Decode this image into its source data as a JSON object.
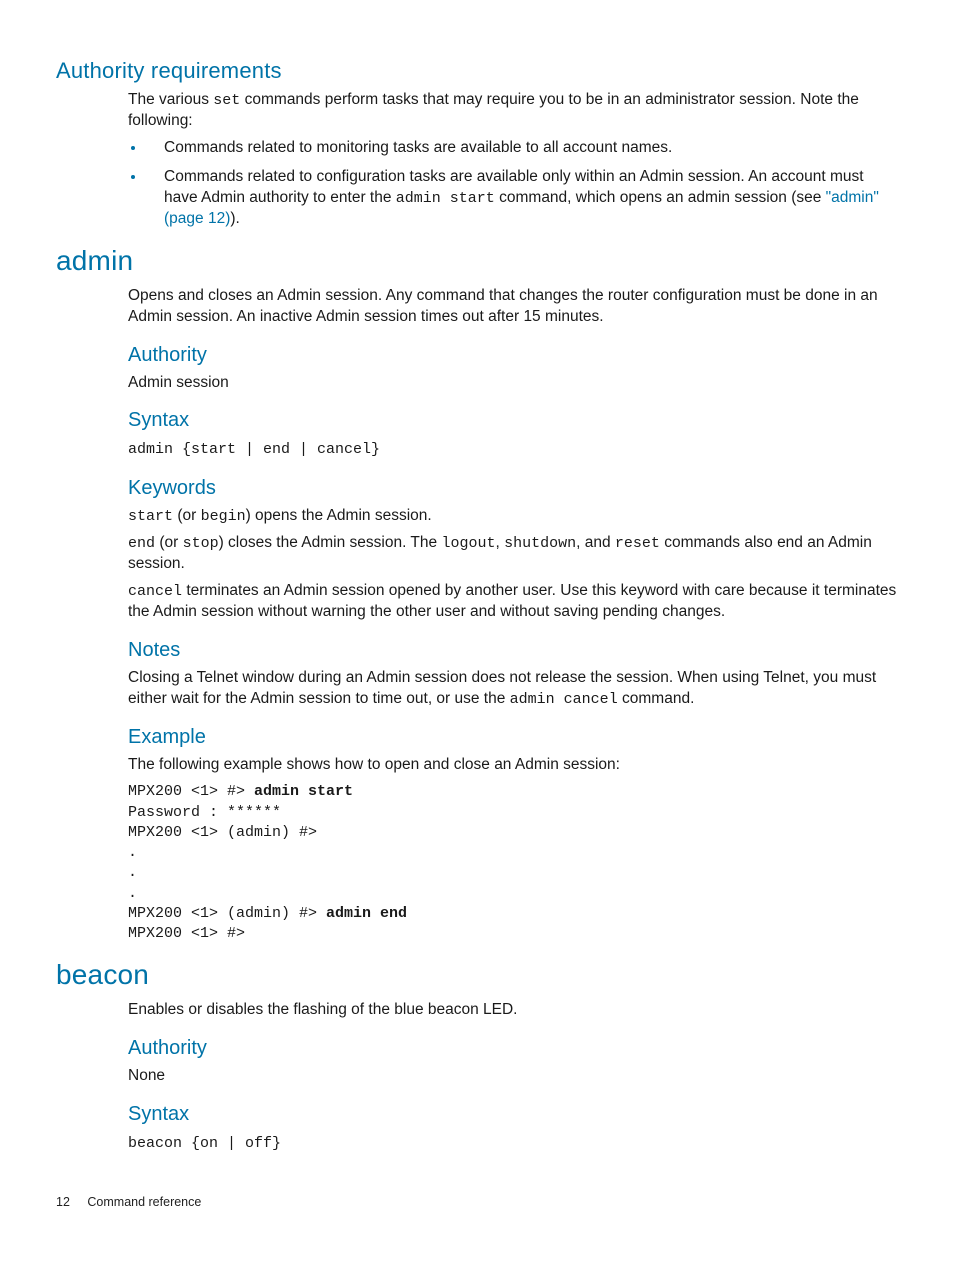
{
  "section_authreq": {
    "title": "Authority requirements",
    "para1_a": "The various ",
    "para1_code": "set",
    "para1_b": " commands perform tasks that may require you to be in an administrator session. Note the following:",
    "bullet1": "Commands related to monitoring tasks are available to all account names.",
    "bullet2_a": "Commands related to configuration tasks are available only within an Admin session. An account must have Admin authority to enter the ",
    "bullet2_code": "admin start",
    "bullet2_b": " command, which opens an admin session (see ",
    "bullet2_link": "\"admin\" (page 12)",
    "bullet2_c": ")."
  },
  "section_admin": {
    "title": "admin",
    "desc": "Opens and closes an Admin session. Any command that changes the router configuration must be done in an Admin session. An inactive Admin session times out after 15 minutes.",
    "authority_h": "Authority",
    "authority_v": "Admin session",
    "syntax_h": "Syntax",
    "syntax_v": "admin {start | end | cancel}",
    "keywords_h": "Keywords",
    "kw_p1_a": "start",
    "kw_p1_b": " (or ",
    "kw_p1_c": "begin",
    "kw_p1_d": ") opens the Admin session.",
    "kw_p2_a": "end",
    "kw_p2_b": " (or ",
    "kw_p2_c": "stop",
    "kw_p2_d": ") closes the Admin session. The ",
    "kw_p2_e": "logout",
    "kw_p2_f": ", ",
    "kw_p2_g": "shutdown",
    "kw_p2_h": ", and ",
    "kw_p2_i": "reset",
    "kw_p2_j": " commands also end an Admin session.",
    "kw_p3_a": "cancel",
    "kw_p3_b": " terminates an Admin session opened by another user. Use this keyword with care because it terminates the Admin session without warning the other user and without saving pending changes.",
    "notes_h": "Notes",
    "notes_a": "Closing a Telnet window during an Admin session does not release the session. When using Telnet, you must either wait for the Admin session to time out, or use the ",
    "notes_code": "admin cancel",
    "notes_b": " command.",
    "example_h": "Example",
    "example_intro": "The following example shows how to open and close an Admin session:",
    "example_l1a": "MPX200 <1> #> ",
    "example_l1b": "admin start",
    "example_l2": "Password : ******",
    "example_l3": "MPX200 <1> (admin) #>",
    "example_l4": ".",
    "example_l5": ".",
    "example_l6": ".",
    "example_l7a": "MPX200 <1> (admin) #> ",
    "example_l7b": "admin end",
    "example_l8": "MPX200 <1> #>"
  },
  "section_beacon": {
    "title": "beacon",
    "desc": "Enables or disables the flashing of the blue beacon LED.",
    "authority_h": "Authority",
    "authority_v": "None",
    "syntax_h": "Syntax",
    "syntax_v": "beacon {on | off}"
  },
  "footer": {
    "page": "12",
    "label": "Command reference"
  }
}
